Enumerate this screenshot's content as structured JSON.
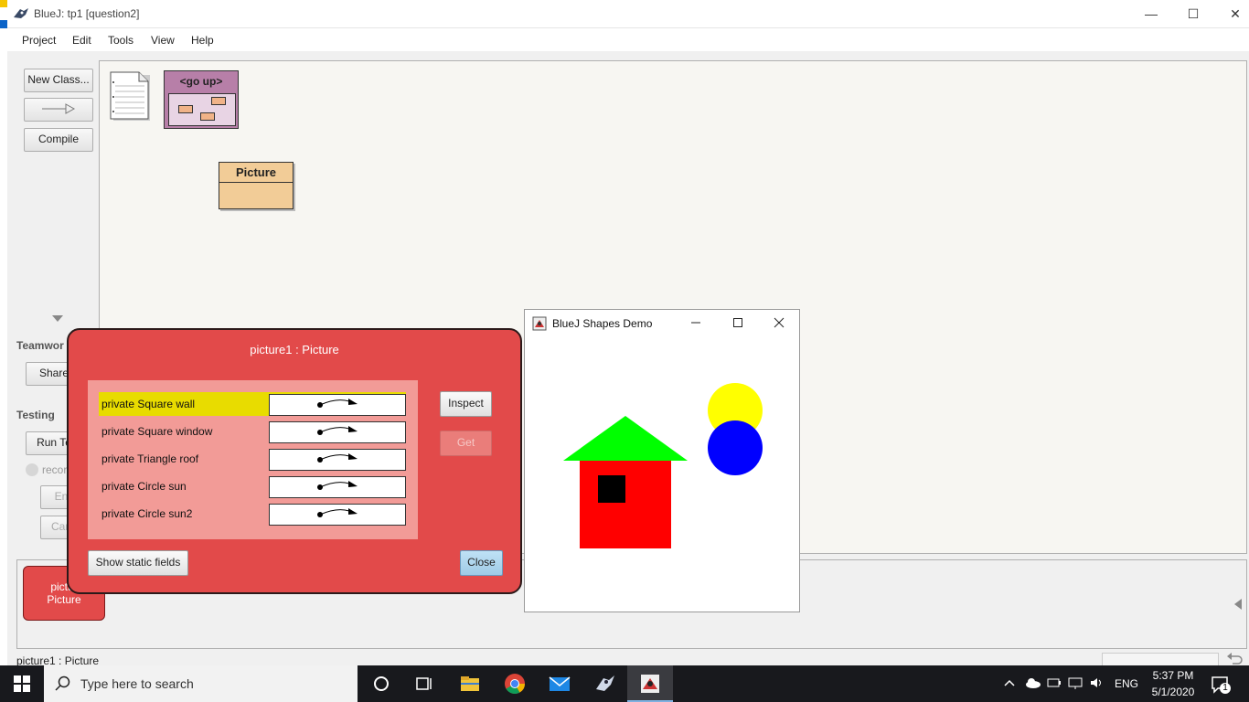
{
  "window": {
    "title": "BlueJ:  tp1  [question2]",
    "controls": [
      "—",
      "☐",
      "✕"
    ]
  },
  "menu": [
    "Project",
    "Edit",
    "Tools",
    "View",
    "Help"
  ],
  "sidebar": {
    "new_class": "New Class...",
    "compile": "Compile",
    "teamwork_label": "Teamwor",
    "share_label": "Share",
    "testing_label": "Testing",
    "run_tests_label": "Run Te",
    "recording_label": "recor",
    "end_label": "En",
    "cancel_label": "Can"
  },
  "diagram": {
    "goup_label": "<go up>",
    "class_name": "Picture"
  },
  "object_bench": {
    "object_line1": "pictur",
    "object_line2": "Picture"
  },
  "status": {
    "text": "picture1 : Picture"
  },
  "inspector": {
    "title": "picture1 : Picture",
    "fields": [
      {
        "label": "private Square wall",
        "selected": true
      },
      {
        "label": "private Square window",
        "selected": false
      },
      {
        "label": "private Triangle roof",
        "selected": false
      },
      {
        "label": "private Circle sun",
        "selected": false
      },
      {
        "label": "private Circle sun2",
        "selected": false
      }
    ],
    "inspect_button": "Inspect",
    "get_button": "Get",
    "static_fields_button": "Show static fields",
    "close_button": "Close"
  },
  "shapes_window": {
    "title": "BlueJ Shapes Demo",
    "colors": {
      "wall": "#ff0000",
      "roof": "#00ff00",
      "window": "#000000",
      "sun": "#ffff00",
      "sun2": "#0000ff"
    }
  },
  "taskbar": {
    "search_placeholder": "Type here to search",
    "language": "ENG",
    "time": "5:37 PM",
    "date": "5/1/2020",
    "notification_count": "1"
  }
}
